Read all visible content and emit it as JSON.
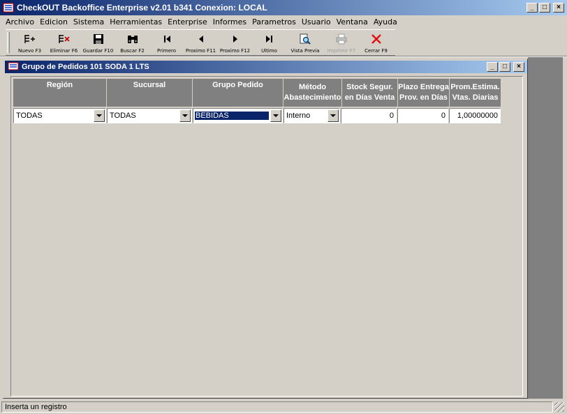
{
  "app": {
    "title": "CheckOUT Backoffice Enterprise v2.01 b341 Conexion: LOCAL",
    "window_buttons": {
      "minimize": "_",
      "maximize": "□",
      "close": "×"
    }
  },
  "menubar": {
    "items": [
      "Archivo",
      "Edicion",
      "Sistema",
      "Herramientas",
      "Enterprise",
      "Informes",
      "Parametros",
      "Usuario",
      "Ventana",
      "Ayuda"
    ]
  },
  "toolbar": {
    "buttons": [
      {
        "label": "Nuevo F3",
        "icon": "new-record-icon",
        "glyph": "☰"
      },
      {
        "label": "Eliminar F6",
        "icon": "delete-record-icon",
        "glyph": "☰"
      },
      {
        "label": "Guardar F10",
        "icon": "save-icon",
        "glyph": "■"
      },
      {
        "label": "Buscar F2",
        "icon": "binoculars-icon",
        "glyph": "⌕"
      },
      {
        "label": "Primero",
        "icon": "first-icon",
        "glyph": "|◀"
      },
      {
        "label": "Proximo F11",
        "icon": "previous-icon",
        "glyph": "◀"
      },
      {
        "label": "Proximo F12",
        "icon": "next-icon",
        "glyph": "▶"
      },
      {
        "label": "Ultimo",
        "icon": "last-icon",
        "glyph": "▶|"
      },
      {
        "label": "Vista Previa",
        "icon": "preview-icon",
        "glyph": "🔍"
      },
      {
        "label": "Imprimir F7",
        "icon": "print-icon",
        "glyph": "⎙"
      },
      {
        "label": "Cerrar F9",
        "icon": "close-x-icon",
        "glyph": "✕"
      }
    ],
    "accent_close": "#e01010"
  },
  "child_window": {
    "title": "Grupo de Pedidos 101 SODA 1 LTS"
  },
  "grid": {
    "headers": [
      "Región",
      "Sucursal",
      "Grupo Pedido",
      "Método\nAbastecimiento",
      "Stock Segur.\nen Días Venta",
      "Plazo Entrega\nProv. en Días",
      "Prom.Estima.\nVtas. Diarias"
    ],
    "row": {
      "region": "TODAS",
      "sucursal": "TODAS",
      "grupo_pedido": "BEBIDAS",
      "metodo": "Interno",
      "stock_segur": "0",
      "plazo_entrega": "0",
      "prom_estima": "1,00000000"
    }
  },
  "status": {
    "text": "Inserta un registro"
  },
  "colors": {
    "title_start": "#0a246a",
    "title_end": "#a6caf0",
    "header_bg": "#808080",
    "face": "#d4d0c8"
  }
}
